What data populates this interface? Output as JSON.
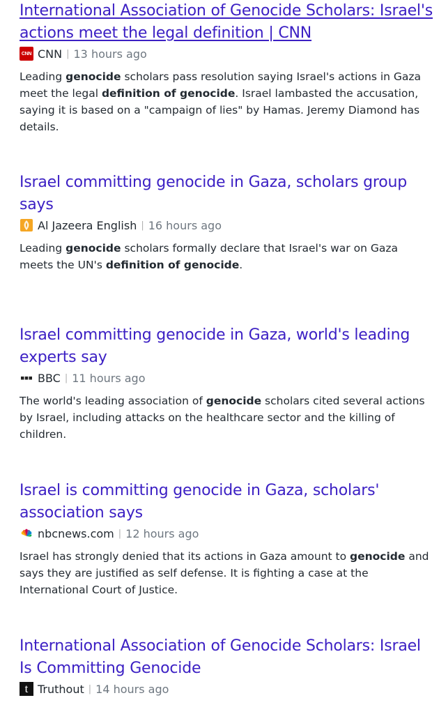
{
  "articles": [
    {
      "title": "International Association of Genocide Scholars: Israel's actions meet the legal definition | CNN",
      "source": "CNN",
      "time": "13 hours ago",
      "logo_icon": "cnn-logo",
      "visited": true,
      "snippet": [
        {
          "t": "Leading ",
          "b": false
        },
        {
          "t": "genocide",
          "b": true
        },
        {
          "t": " scholars pass resolution saying Israel's actions in Gaza meet the legal ",
          "b": false
        },
        {
          "t": "definition of genocide",
          "b": true
        },
        {
          "t": ". Israel lambasted the accusation, saying it is based on a \"campaign of lies\" by Hamas. Jeremy Diamond has details.",
          "b": false
        }
      ]
    },
    {
      "title": "Israel committing genocide in Gaza, scholars group says",
      "source": "Al Jazeera English",
      "time": "16 hours ago",
      "logo_icon": "aljazeera-logo",
      "visited": false,
      "snippet": [
        {
          "t": "Leading ",
          "b": false
        },
        {
          "t": "genocide",
          "b": true
        },
        {
          "t": " scholars formally declare that Israel's war on Gaza meets the UN's ",
          "b": false
        },
        {
          "t": "definition of genocide",
          "b": true
        },
        {
          "t": ".",
          "b": false
        }
      ]
    },
    {
      "title": "Israel committing genocide in Gaza, world's leading experts say",
      "source": "BBC",
      "time": "11 hours ago",
      "logo_icon": "bbc-logo",
      "visited": false,
      "snippet": [
        {
          "t": "The world's leading association of ",
          "b": false
        },
        {
          "t": "genocide",
          "b": true
        },
        {
          "t": " scholars cited several actions by Israel, including attacks on the healthcare sector and the killing of children.",
          "b": false
        }
      ]
    },
    {
      "title": "Israel is committing genocide in Gaza, scholars' association says",
      "source": "nbcnews.com",
      "time": "12 hours ago",
      "logo_icon": "nbc-peacock-logo",
      "visited": false,
      "snippet": [
        {
          "t": "Israel has strongly denied that its actions in Gaza amount to ",
          "b": false
        },
        {
          "t": "genocide",
          "b": true
        },
        {
          "t": " and says they are justified as self defense. It is fighting a case at the International Court of Justice.",
          "b": false
        }
      ]
    },
    {
      "title": "International Association of Genocide Scholars: Israel Is Committing Genocide",
      "source": "Truthout",
      "time": "14 hours ago",
      "logo_icon": "truthout-logo",
      "visited": false,
      "snippet": []
    }
  ],
  "logo_text": {
    "cnn": "CNN",
    "truthout": "t"
  },
  "colors": {
    "link": "#3c20c4",
    "meta_time": "#6e7780",
    "text": "#232a31"
  }
}
